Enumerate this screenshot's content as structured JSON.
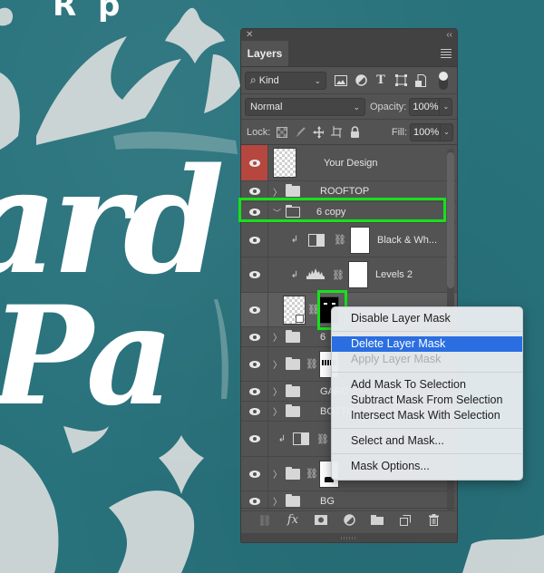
{
  "canvas": {
    "background_color": "#28727c",
    "artwork_text_top": "ard",
    "artwork_text_bottom": "Pa",
    "artwork_text_heading": "R        p"
  },
  "panel": {
    "close_glyph": "✕",
    "collapse_glyph": "‹‹",
    "tab_label": "Layers",
    "filter": {
      "kind_label": "Kind",
      "search_glyph": "⌕",
      "icons": [
        "image-filter-icon",
        "adjustment-filter-icon",
        "type-filter-icon",
        "shape-filter-icon",
        "smart-object-filter-icon"
      ]
    },
    "blend_mode": "Normal",
    "opacity_label": "Opacity:",
    "opacity_value": "100%",
    "lock_label": "Lock:",
    "fill_label": "Fill:",
    "fill_value": "100%",
    "layers": [
      {
        "name": "Your Design",
        "type": "smart-object",
        "selected_eye": true
      },
      {
        "name": "ROOFTOP",
        "type": "group",
        "expanded": false
      },
      {
        "name": "6 copy",
        "type": "group",
        "expanded": true,
        "highlighted": true
      },
      {
        "name": "Black & Wh...",
        "type": "adjustment",
        "clipped": true
      },
      {
        "name": "Levels 2",
        "type": "adjustment",
        "clipped": true
      },
      {
        "name": "",
        "type": "smart-object-with-mask",
        "mask_highlighted": true
      },
      {
        "name": "6",
        "type": "group",
        "expanded": false
      },
      {
        "name": "",
        "type": "group-with-mask",
        "expanded": false
      },
      {
        "name": "GARD",
        "type": "group",
        "expanded": false
      },
      {
        "name": "BOTTO",
        "type": "group",
        "expanded": false
      },
      {
        "name": "",
        "type": "adjustment",
        "clipped": true
      },
      {
        "name": "",
        "type": "group-with-mask",
        "expanded": false
      },
      {
        "name": "BG",
        "type": "group",
        "expanded": false
      }
    ],
    "footer_icons": [
      "link-layers-icon",
      "fx-icon",
      "add-mask-icon",
      "new-adjustment-icon",
      "new-group-icon",
      "new-layer-icon",
      "delete-icon"
    ],
    "footer_glyphs": {
      "link": "⛓",
      "fx": "fx",
      "mask": "◙",
      "adjust": "◐",
      "group": "▬",
      "new": "❐",
      "trash": "🗑"
    }
  },
  "context_menu": {
    "groups": [
      [
        {
          "label": "Disable Layer Mask",
          "state": "normal"
        }
      ],
      [
        {
          "label": "Delete Layer Mask",
          "state": "active"
        },
        {
          "label": "Apply Layer Mask",
          "state": "disabled"
        }
      ],
      [
        {
          "label": "Add Mask To Selection",
          "state": "normal"
        },
        {
          "label": "Subtract Mask From Selection",
          "state": "normal"
        },
        {
          "label": "Intersect Mask With Selection",
          "state": "normal"
        }
      ],
      [
        {
          "label": "Select and Mask...",
          "state": "normal"
        }
      ],
      [
        {
          "label": "Mask Options...",
          "state": "normal"
        }
      ]
    ]
  },
  "colors": {
    "highlight_green": "#17e11b",
    "menu_active": "#2a6ee1",
    "eye_selected_bg": "#b5473f",
    "panel_bg": "#535353"
  }
}
